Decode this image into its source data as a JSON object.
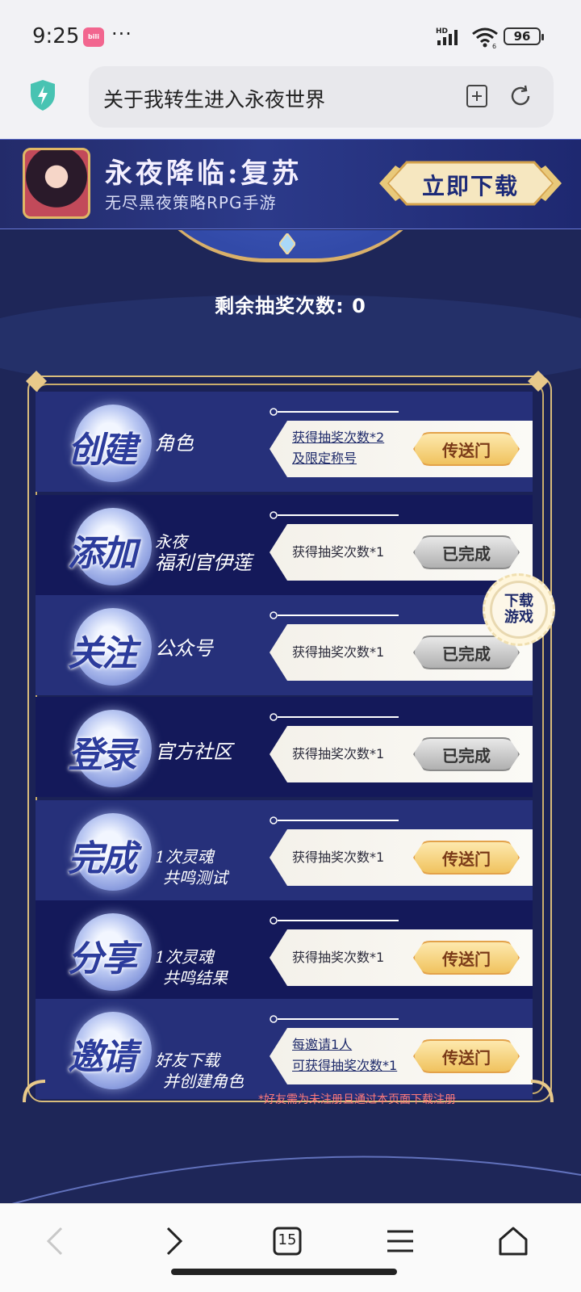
{
  "status_bar": {
    "time": "9:25",
    "app_badge": "bilibili",
    "more": "···",
    "network": "HD",
    "wifi_label": "6",
    "battery": "96"
  },
  "browser": {
    "page_title": "关于我转生进入永夜世界",
    "tab_count": "15"
  },
  "banner": {
    "title": "永夜降临:复苏",
    "subtitle": "无尽黑夜策略RPG手游",
    "download_label": "立即下载"
  },
  "lottery": {
    "remaining_label": "剩余抽奖次数: 0"
  },
  "tasks": [
    {
      "badge": "创建",
      "sub": [
        "角色"
      ],
      "desc": [
        "获得抽奖次数*2",
        "及限定称号"
      ],
      "desc_link": true,
      "button": "传送门",
      "state": "go"
    },
    {
      "badge": "添加",
      "sub": [
        "永夜",
        "福利官伊莲"
      ],
      "desc": [
        "获得抽奖次数*1"
      ],
      "desc_link": false,
      "button": "已完成",
      "state": "done"
    },
    {
      "badge": "关注",
      "sub": [
        "公众号"
      ],
      "desc": [
        "获得抽奖次数*1"
      ],
      "desc_link": false,
      "button": "已完成",
      "state": "done"
    },
    {
      "badge": "登录",
      "sub": [
        "官方社区"
      ],
      "desc": [
        "获得抽奖次数*1"
      ],
      "desc_link": false,
      "button": "已完成",
      "state": "done"
    },
    {
      "badge": "完成",
      "sub": [
        "1次灵魂",
        "共鸣测试"
      ],
      "desc": [
        "获得抽奖次数*1"
      ],
      "desc_link": false,
      "button": "传送门",
      "state": "go"
    },
    {
      "badge": "分享",
      "sub": [
        "1次灵魂",
        "共鸣结果"
      ],
      "desc": [
        "获得抽奖次数*1"
      ],
      "desc_link": false,
      "button": "传送门",
      "state": "go"
    },
    {
      "badge": "邀请",
      "sub": [
        "好友下载",
        "并创建角色"
      ],
      "desc": [
        "每邀请1人",
        "可获得抽奖次数*1"
      ],
      "desc_link": true,
      "button": "传送门",
      "state": "go"
    }
  ],
  "note": "*好友需为未注册且通过本页面下载注册",
  "float_download": [
    "下载",
    "游戏"
  ],
  "colors": {
    "page_bg": "#1e2658",
    "gold": "#d9bd7c",
    "button_go": "#f0c25e",
    "button_done": "#b0b0b0",
    "note_red": "#ff7a7a"
  },
  "icons": [
    "security-shield-icon",
    "bookmark-add-icon",
    "reload-icon",
    "back-icon",
    "forward-icon",
    "tabs-icon",
    "menu-icon",
    "home-icon"
  ]
}
